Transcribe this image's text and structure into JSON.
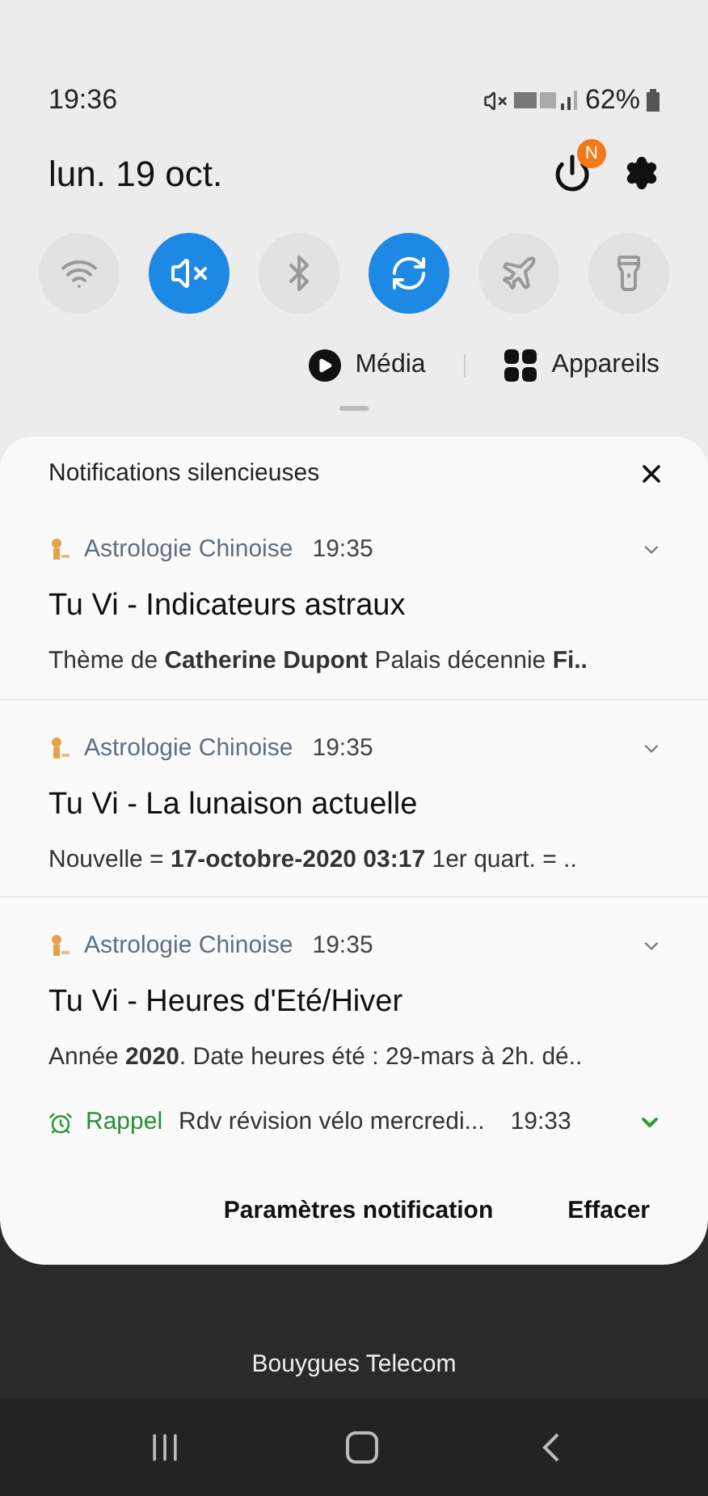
{
  "status_bar": {
    "time": "19:36",
    "battery": "62%"
  },
  "header": {
    "date": "lun. 19 oct.",
    "power_badge": "N"
  },
  "quick_toggles": [
    {
      "kind": "wifi",
      "on": false
    },
    {
      "kind": "mute",
      "on": true
    },
    {
      "kind": "bluetooth",
      "on": false
    },
    {
      "kind": "rotate",
      "on": true
    },
    {
      "kind": "airplane",
      "on": false
    },
    {
      "kind": "flashlight",
      "on": false
    }
  ],
  "media_buttons": [
    {
      "kind": "media",
      "label": "Média"
    },
    {
      "kind": "devices",
      "label": "Appareils"
    }
  ],
  "panel": {
    "title": "Notifications silencieuses",
    "notifications": [
      {
        "kind": "app",
        "app": "Astrologie Chinoise",
        "time": "19:35",
        "title": "Tu Vi - Indicateurs astraux",
        "body": "Thème de **Catherine Dupont** Palais décennie **Fi..**"
      },
      {
        "kind": "app",
        "app": "Astrologie Chinoise",
        "time": "19:35",
        "title": "Tu Vi - La lunaison actuelle",
        "body": "Nouvelle = **17-octobre-2020 03:17** 1er quart. = .."
      },
      {
        "kind": "app",
        "app": "Astrologie Chinoise",
        "time": "19:35",
        "title": "Tu Vi - Heures d'Eté/Hiver",
        "body": "Année **2020**. Date heures été : 29-mars à 2h. dé.."
      },
      {
        "kind": "reminder",
        "app": "Rappel",
        "text": "Rdv révision vélo mercredi...",
        "time": "19:33"
      }
    ],
    "actions": [
      "Paramètres notification",
      "Effacer"
    ]
  },
  "carrier": "Bouygues Telecom"
}
